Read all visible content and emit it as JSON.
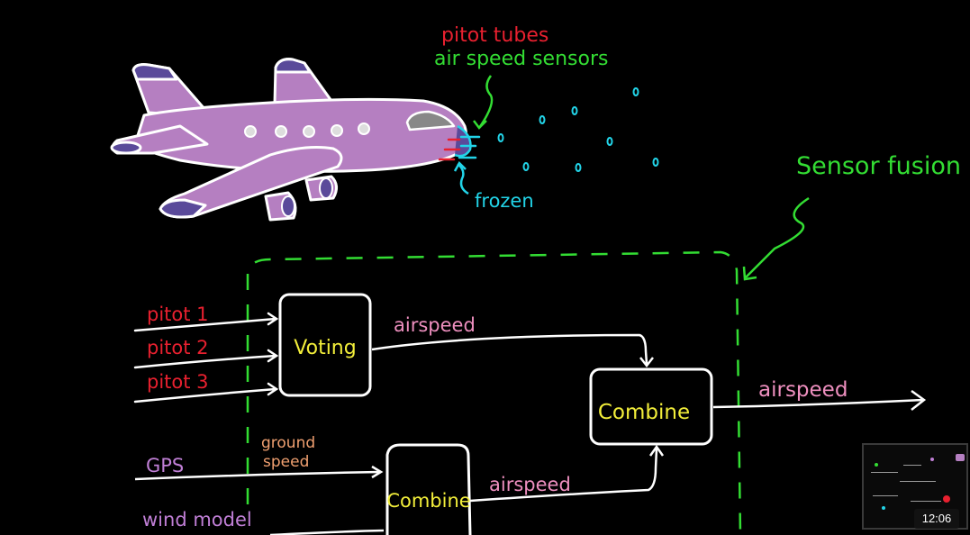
{
  "labels": {
    "pitot_tubes": "pitot tubes",
    "air_speed_sensors": "air speed sensors",
    "frozen": "frozen",
    "sensor_fusion": "Sensor fusion",
    "pitot_1": "pitot 1",
    "pitot_2": "pitot 2",
    "pitot_3": "pitot 3",
    "gps": "GPS",
    "wind_model": "wind model",
    "ground": "ground",
    "speed": "speed",
    "voting": "Voting",
    "combine_top": "Combine",
    "combine_bottom": "Combine",
    "airspeed_top": "airspeed",
    "airspeed_bottom": "airspeed",
    "airspeed_output": "airspeed"
  },
  "video": {
    "time": "12:06"
  },
  "colors": {
    "background": "#000000",
    "red": "#e8202f",
    "green": "#33dd33",
    "cyan": "#22d4e8",
    "pink": "#ee8fbf",
    "yellow": "#f2ee3a",
    "purple": "#c07fd6",
    "orange": "#f0a070",
    "plane_body": "#b57fc1",
    "plane_accent": "#5a4a9a"
  }
}
